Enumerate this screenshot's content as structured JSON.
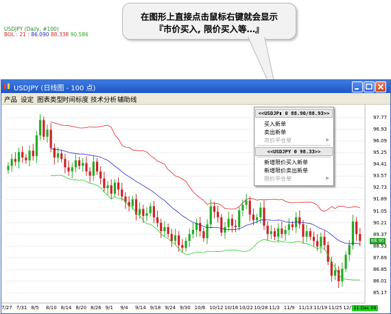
{
  "callout": {
    "line1": "在图形上直接点击鼠标右键就会显示",
    "line2": "『市价买入, 限价买入等…』"
  },
  "window": {
    "title": "USDJPY (日线图 - 100 点)",
    "buttons": [
      "minimize",
      "maximize",
      "close"
    ]
  },
  "menu": [
    "产品",
    "设定",
    "图表类型",
    "时间标度",
    "技术分析",
    "辅助线"
  ],
  "legend": {
    "line1": "USDJPY (Daily, #100)",
    "label": "BOL : 21 :",
    "v1": "86.090",
    "v2": "88.338",
    "v3": "90.586"
  },
  "y_axis": [
    "97.77",
    "96.93",
    "96.09",
    "95.25",
    "94.41",
    "93.57",
    "92.73",
    "91.89",
    "91.05",
    "90.21",
    "89.37",
    "88.53",
    "87.69",
    "86.85",
    "86.01",
    "85.17"
  ],
  "x_axis": [
    "7/27",
    "7/31",
    "8/5",
    "8/10",
    "8/14",
    "8/20",
    "8/26",
    "9/1",
    "9/4",
    "9/14",
    "9/18",
    "9/24",
    "9/30",
    "10/6",
    "10/12",
    "10/16",
    "10/22",
    "10/28",
    "11/3",
    "11/9",
    "11/13",
    "11/19",
    "11/25",
    "12/1",
    "12"
  ],
  "price_tag": "88.90",
  "date_tag": "11 Dec 09",
  "context_menu": {
    "header1": "<<USDJP▮ 0 88.90/88.93>>",
    "items1": [
      {
        "label": "买入新单",
        "disabled": false
      },
      {
        "label": "卖出新单",
        "disabled": false
      },
      {
        "label": "市价平仓单",
        "disabled": true,
        "submenu": true
      }
    ],
    "header2": "<<USDJPY 0 98.33>>",
    "items2": [
      {
        "label": "新增限价买入新单",
        "disabled": false
      },
      {
        "label": "新增限价卖出新单",
        "disabled": false
      },
      {
        "label": "限价平仓单",
        "disabled": true,
        "submenu": true
      }
    ]
  },
  "colors": {
    "up_candle": "#22aa22",
    "down_candle": "#cc2222",
    "upper_band": "#dd2222",
    "middle_band": "#2222cc",
    "lower_band": "#22cc22",
    "titlebar": "#2a62d0"
  },
  "chart_data": {
    "type": "candlestick",
    "title": "USDJPY (Daily, #100)",
    "ylim": [
      85.17,
      97.77
    ],
    "y_ticks": [
      97.77,
      96.93,
      96.09,
      95.25,
      94.41,
      93.57,
      92.73,
      91.89,
      91.05,
      90.21,
      89.37,
      88.53,
      87.69,
      86.85,
      86.01,
      85.17
    ],
    "x_labels": [
      "7/27",
      "7/31",
      "8/5",
      "8/10",
      "8/14",
      "8/20",
      "8/26",
      "9/1",
      "9/4",
      "9/14",
      "9/18",
      "9/24",
      "9/30",
      "10/6",
      "10/12",
      "10/16",
      "10/22",
      "10/28",
      "11/3",
      "11/9",
      "11/13",
      "11/19",
      "11/25",
      "12/1",
      "12"
    ],
    "close": [
      94.3,
      94.8,
      94.6,
      95.3,
      94.9,
      94.7,
      95.4,
      95.0,
      96.5,
      97.6,
      96.4,
      96.9,
      95.6,
      94.9,
      95.2,
      94.8,
      94.2,
      93.9,
      94.2,
      94.7,
      94.3,
      94.5,
      93.9,
      93.6,
      94.6,
      93.9,
      93.4,
      92.7,
      92.9,
      92.3,
      93.1,
      92.6,
      92.1,
      91.7,
      91.4,
      91.9,
      90.8,
      91.2,
      90.7,
      90.9,
      91.4,
      90.6,
      90.2,
      89.6,
      89.9,
      89.4,
      88.9,
      89.3,
      88.6,
      88.4,
      88.9,
      89.4,
      89.7,
      90.2,
      89.6,
      89.1,
      90.1,
      91.4,
      91.0,
      90.6,
      89.5,
      89.9,
      90.5,
      90.0,
      89.9,
      91.1,
      91.5,
      91.8,
      90.8,
      90.4,
      90.6,
      91.3,
      90.0,
      89.4,
      89.6,
      89.2,
      89.8,
      89.4,
      89.7,
      90.1,
      89.9,
      90.6,
      90.1,
      89.2,
      89.6,
      89.2,
      88.9,
      88.5,
      89.2,
      88.6,
      87.4,
      86.4,
      86.8,
      86.0,
      86.9,
      87.9,
      88.6,
      90.3,
      89.4,
      88.9
    ],
    "bollinger_period": 21,
    "bollinger_lower": 86.09,
    "bollinger_middle": 88.338,
    "bollinger_upper": 90.586,
    "last_price": 88.9,
    "last_date": "11 Dec 09"
  }
}
